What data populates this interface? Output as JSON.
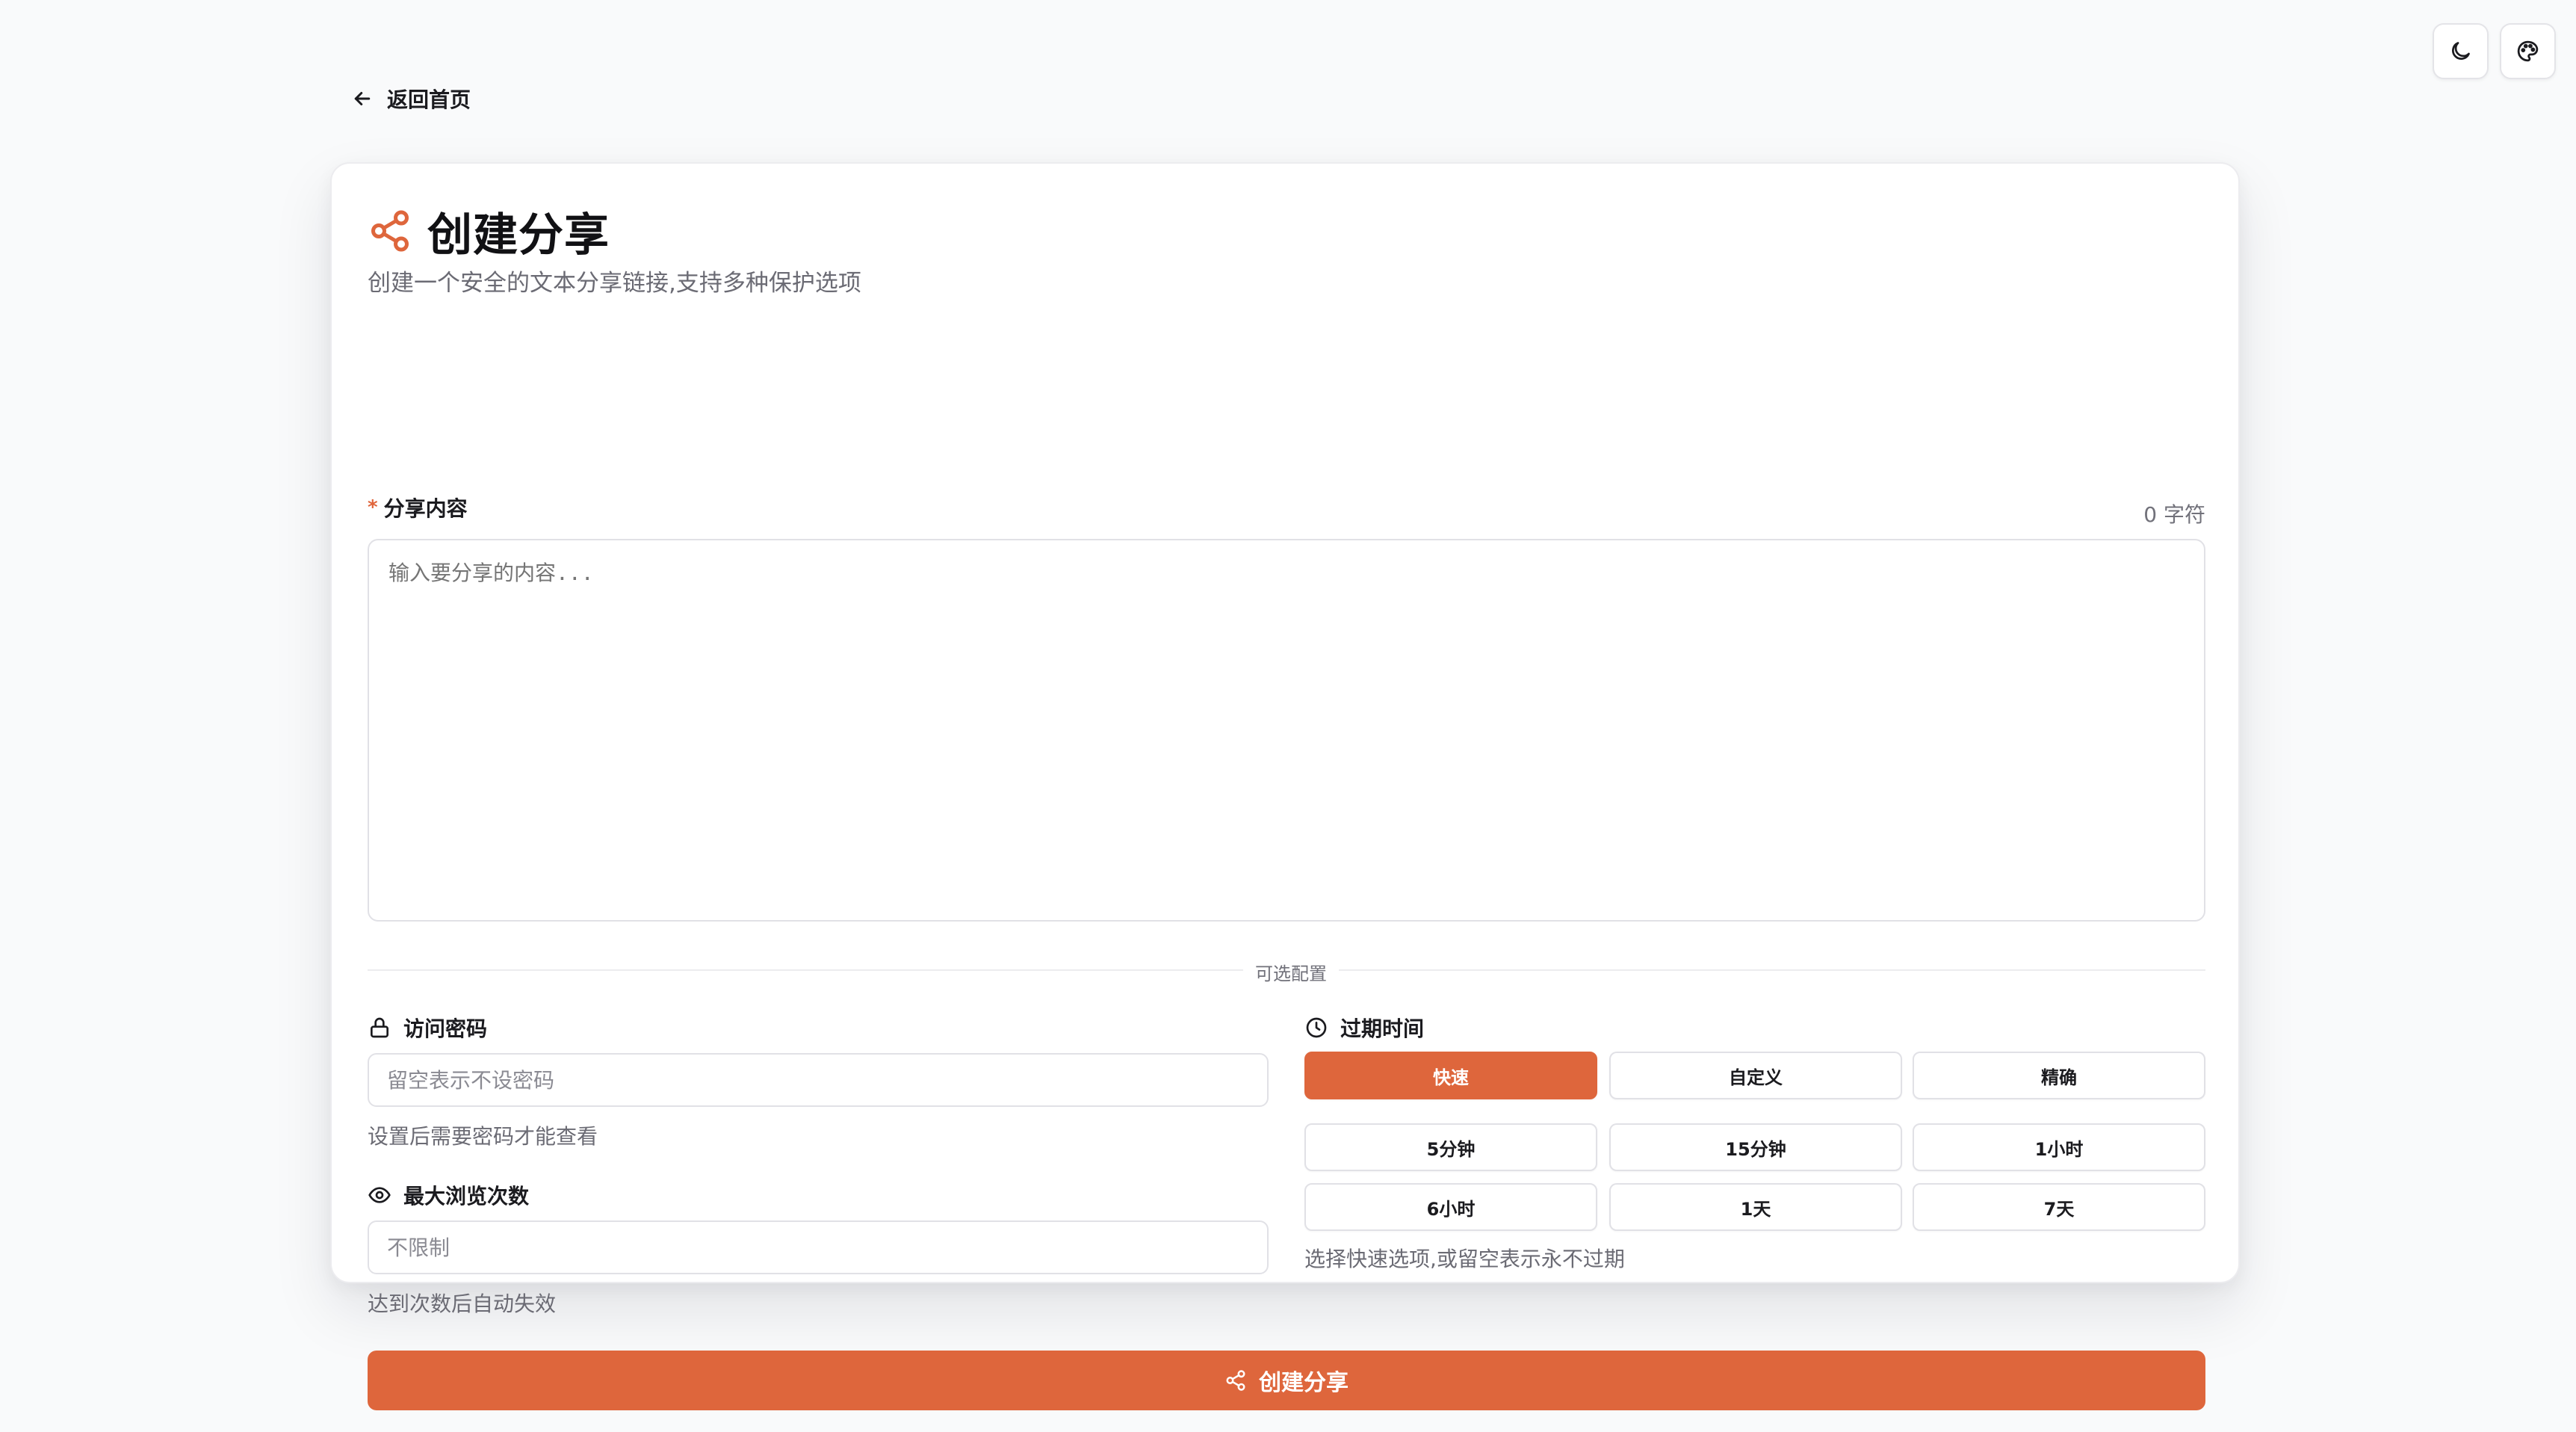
{
  "colors": {
    "accent": "#de663c",
    "background": "#f9fafb",
    "card": "#ffffff",
    "border": "#e1e1e6",
    "muted_text": "#6b6b74"
  },
  "top_controls": {
    "theme_toggle_icon": "moon-icon",
    "palette_icon": "palette-icon"
  },
  "nav": {
    "back_label": "返回首页",
    "back_icon": "arrow-left-icon"
  },
  "header": {
    "icon": "share-icon",
    "title": "创建分享",
    "subtitle": "创建一个安全的文本分享链接,支持多种保护选项"
  },
  "content": {
    "required_mark": "*",
    "label": "分享内容",
    "char_count": "0 字符",
    "placeholder": "输入要分享的内容..."
  },
  "optional_divider": "可选配置",
  "password": {
    "icon": "lock-icon",
    "label": "访问密码",
    "placeholder": "留空表示不设密码",
    "hint": "设置后需要密码才能查看"
  },
  "max_views": {
    "icon": "eye-icon",
    "label": "最大浏览次数",
    "placeholder": "不限制",
    "hint": "达到次数后自动失效"
  },
  "expiry": {
    "icon": "clock-icon",
    "label": "过期时间",
    "modes": [
      "快速",
      "自定义",
      "精确"
    ],
    "active_mode": "快速",
    "options": [
      "5分钟",
      "15分钟",
      "1小时",
      "6小时",
      "1天",
      "7天"
    ],
    "hint": "选择快速选项,或留空表示永不过期"
  },
  "submit": {
    "icon": "share-icon",
    "label": "创建分享"
  }
}
